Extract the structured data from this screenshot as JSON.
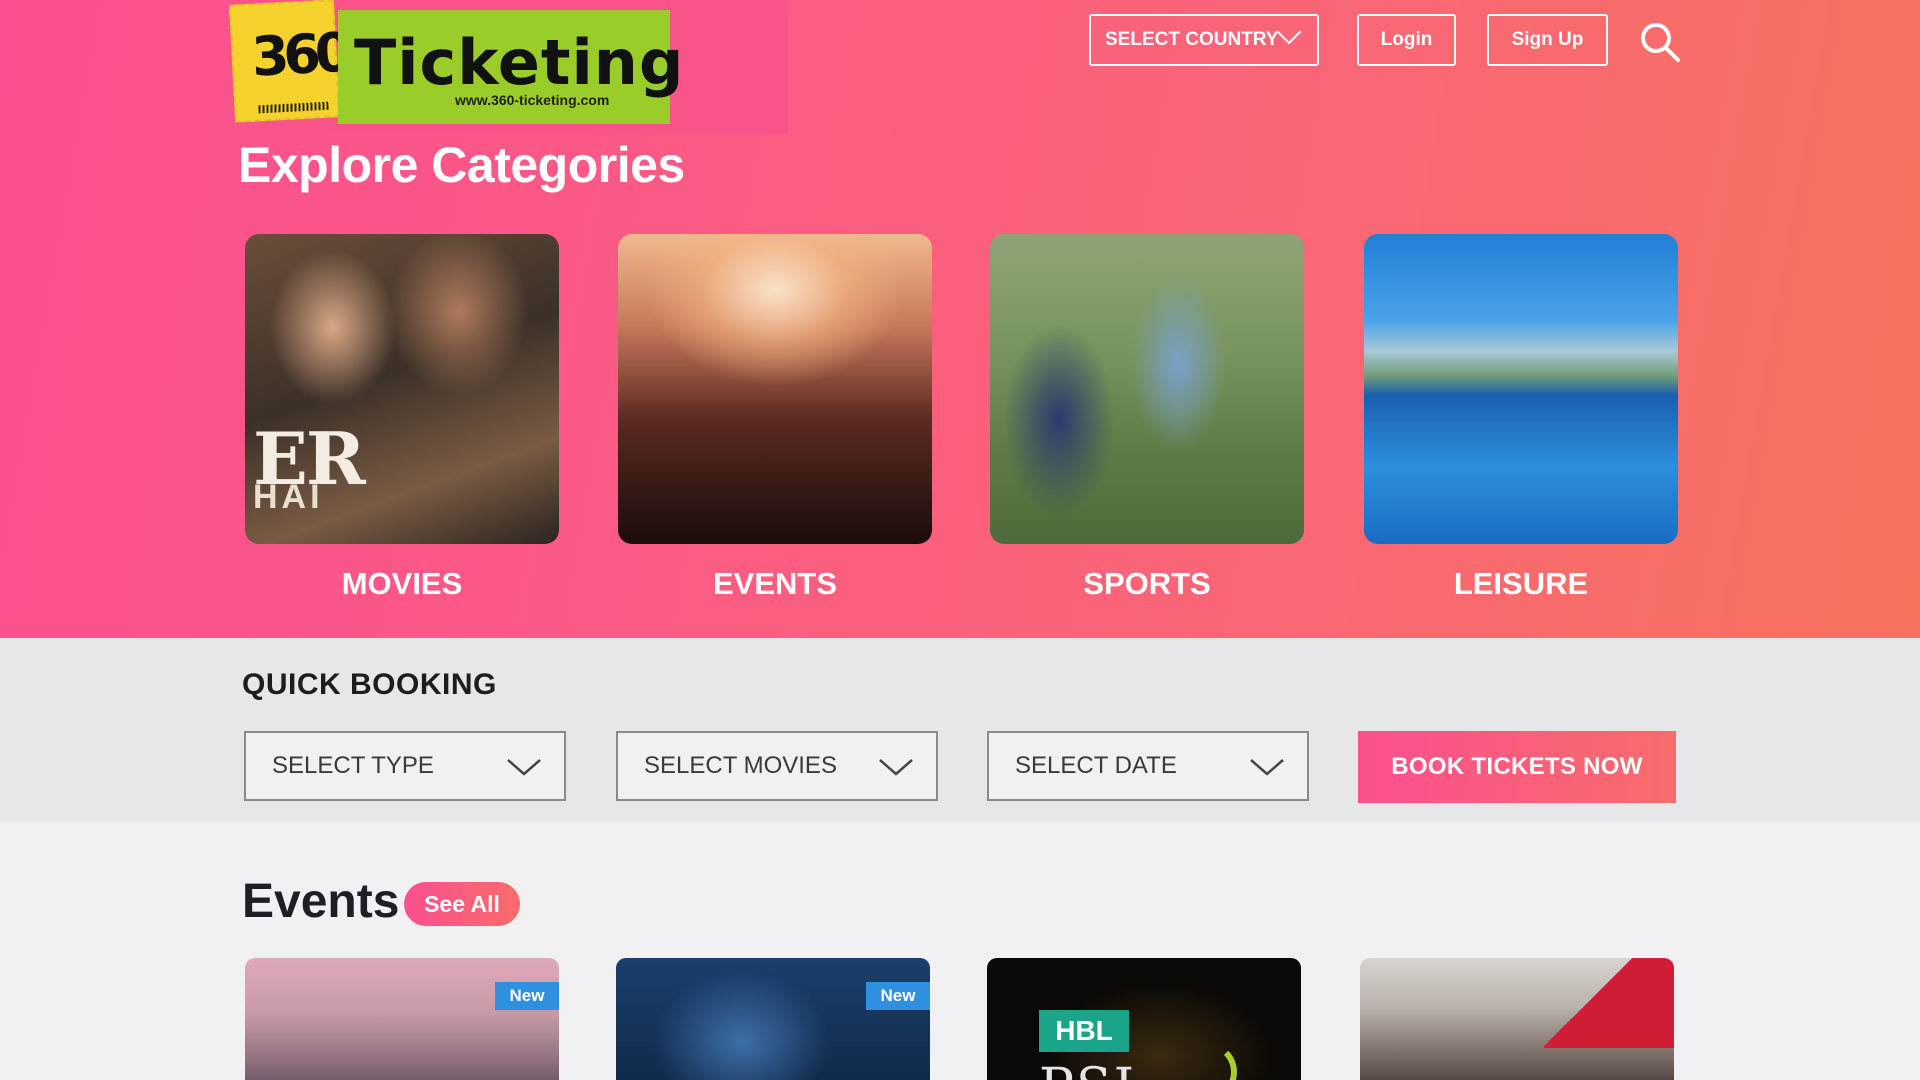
{
  "brand": {
    "logo_number": "360",
    "name": "Ticketing",
    "url": "www.360-ticketing.com"
  },
  "header": {
    "country_select": "SELECT COUNTRY",
    "login": "Login",
    "signup": "Sign Up",
    "search_icon": "search-icon"
  },
  "explore": {
    "title": "Explore Categories",
    "categories": [
      {
        "label": "MOVIES",
        "poster_text_1": "ER",
        "poster_text_2": "HAI"
      },
      {
        "label": "EVENTS"
      },
      {
        "label": "SPORTS"
      },
      {
        "label": "LEISURE"
      }
    ]
  },
  "quick_booking": {
    "title": "QUICK BOOKING",
    "select_type": "SELECT TYPE",
    "select_movies": "SELECT MOVIES",
    "select_date": "SELECT DATE",
    "book_button": "BOOK TICKETS NOW"
  },
  "events": {
    "title": "Events",
    "see_all": "See All",
    "cards": [
      {
        "badge": "New"
      },
      {
        "badge": "New"
      },
      {
        "logo_text": "HBL",
        "logo_sub": "PSL"
      },
      {}
    ]
  },
  "colors": {
    "accent_pink": "#fb4f8f",
    "accent_coral": "#f76c6a",
    "badge_blue": "#2f8fe0",
    "logo_green": "#9acd2a",
    "logo_yellow": "#f6d22c"
  }
}
